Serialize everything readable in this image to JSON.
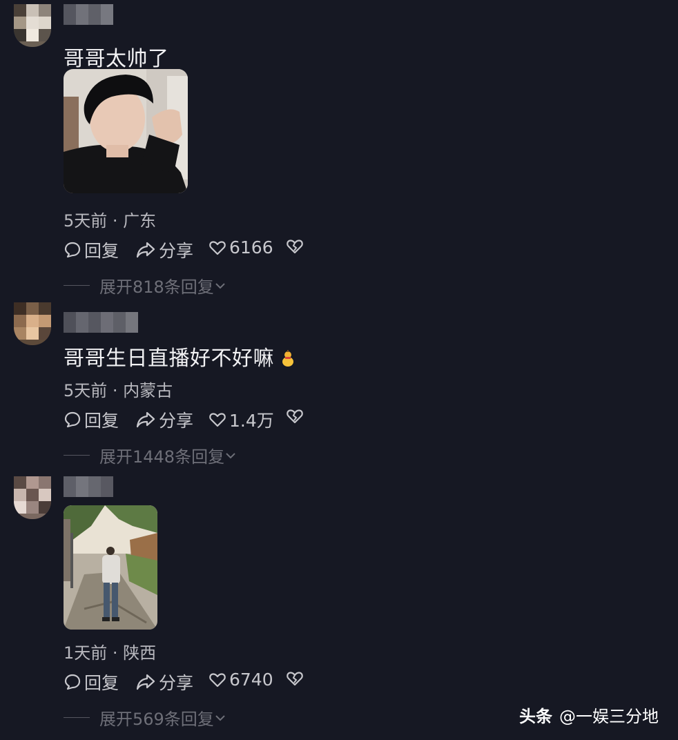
{
  "comments": [
    {
      "text": "哥哥太帅了",
      "meta": "5天前 · 广东",
      "reply_label": "回复",
      "share_label": "分享",
      "likes": "6166",
      "expand_label": "展开818条回复"
    },
    {
      "text": "哥哥生日直播好不好嘛",
      "emoji_icon": "gourd-emoji-icon",
      "meta": "5天前 · 内蒙古",
      "reply_label": "回复",
      "share_label": "分享",
      "likes": "1.4万",
      "expand_label": "展开1448条回复"
    },
    {
      "meta": "1天前 · 陕西",
      "reply_label": "回复",
      "share_label": "分享",
      "likes": "6740",
      "expand_label": "展开569条回复"
    }
  ],
  "watermark": {
    "brand": "头条",
    "handle": "@一娱三分地"
  },
  "colors": {
    "background": "#161823",
    "text": "#f2f2f4",
    "meta": "#b8b8be",
    "muted": "#6e6f78"
  }
}
